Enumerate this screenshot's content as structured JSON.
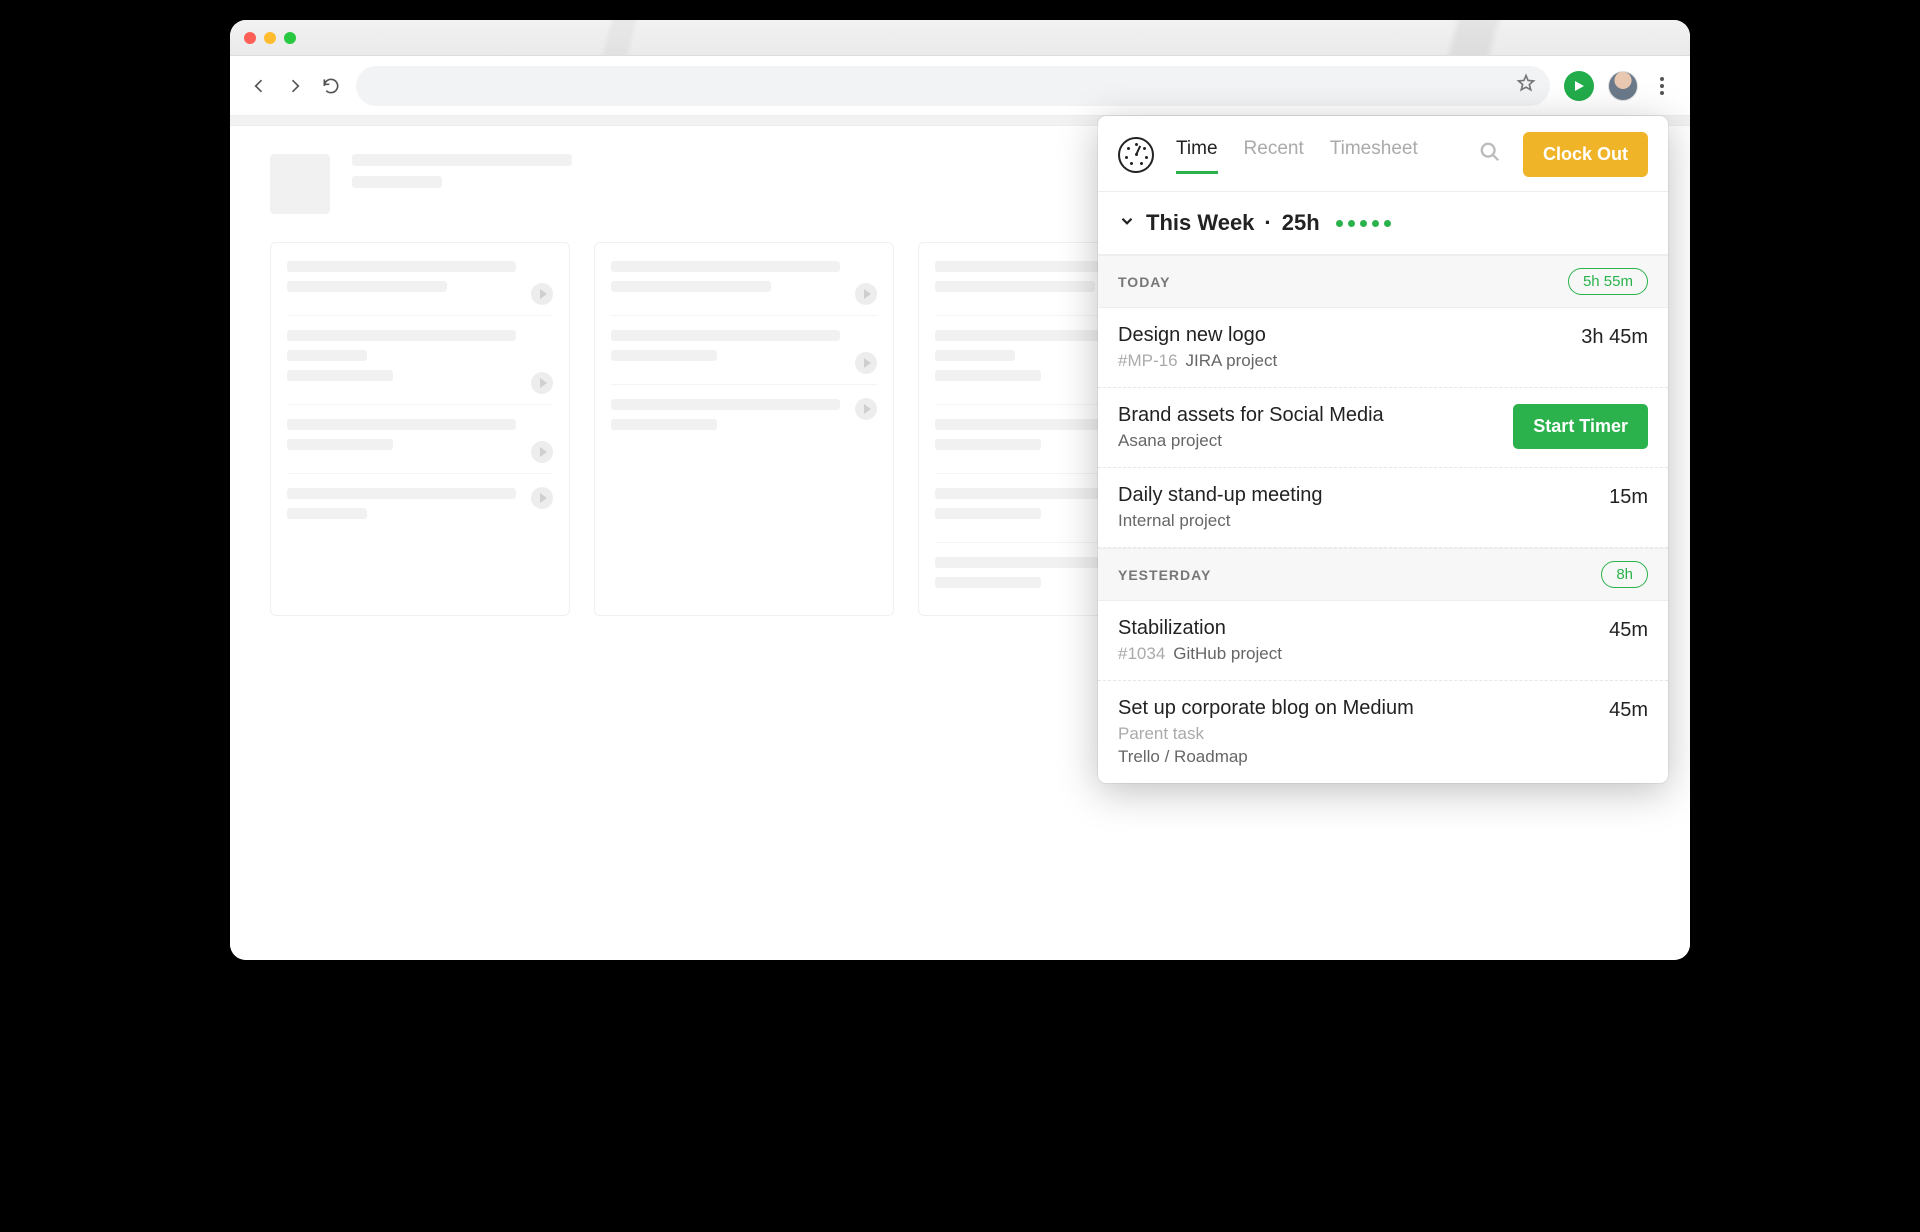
{
  "popup": {
    "tabs": {
      "time": "Time",
      "recent": "Recent",
      "timesheet": "Timesheet"
    },
    "clock_out": "Clock Out",
    "week": {
      "label": "This Week",
      "separator": "·",
      "total": "25h"
    },
    "today": {
      "label": "TODAY",
      "total": "5h 55m",
      "entries": [
        {
          "title": "Design new logo",
          "tag": "#MP-16",
          "sub": "JIRA project",
          "duration": "3h 45m"
        },
        {
          "title": "Brand assets for Social Media",
          "sub": "Asana project",
          "action": "Start Timer"
        },
        {
          "title": "Daily stand-up meeting",
          "sub": "Internal project",
          "duration": "15m"
        }
      ]
    },
    "yesterday": {
      "label": "YESTERDAY",
      "total": "8h",
      "entries": [
        {
          "title": "Stabilization",
          "tag": "#1034",
          "sub": "GitHub project",
          "duration": "45m"
        },
        {
          "title": "Set up corporate blog on Medium",
          "parent": "Parent task",
          "sub": "Trello / Roadmap",
          "duration": "45m"
        }
      ]
    }
  }
}
